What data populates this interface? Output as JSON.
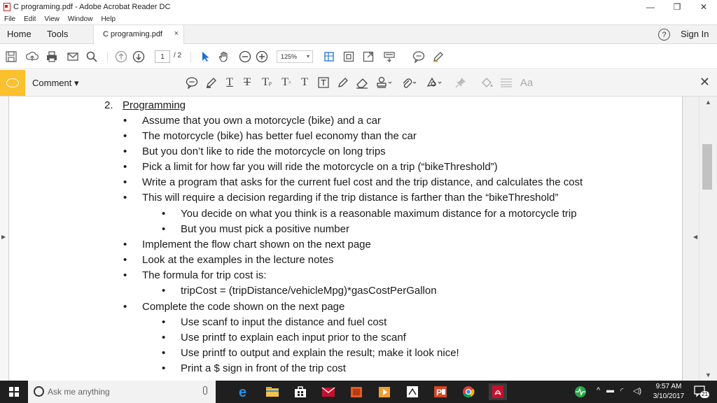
{
  "window": {
    "title": "C programing.pdf - Adobe Acrobat Reader DC",
    "minimize": "—",
    "restore": "❐",
    "close": "✕"
  },
  "menu": [
    "File",
    "Edit",
    "View",
    "Window",
    "Help"
  ],
  "tabs": {
    "home": "Home",
    "tools": "Tools",
    "document": "C programing.pdf",
    "document_close": "×",
    "help": "?",
    "sign_in": "Sign In"
  },
  "toolbar": {
    "current_page": "1",
    "total_pages": "/ 2",
    "zoom": "125%"
  },
  "comment_bar": {
    "label": "Comment ▾",
    "font_size_label": "Aa",
    "close": "✕"
  },
  "document": {
    "heading_number": "2.",
    "heading_title": "Programming",
    "bullet": "•",
    "lines": [
      "Assume that you own a motorcycle (bike) and a car",
      "The motorcycle (bike) has better fuel economy than the car",
      "But you don’t like to ride the motorcycle on long trips",
      "Pick a limit for how far you will ride the motorcycle on a trip (“bikeThreshold”)",
      "Write a program that asks for the current fuel cost and the trip distance, and calculates the cost",
      "This will require a decision regarding if the trip distance is farther than the “bikeThreshold”",
      "You decide on what you think is a reasonable maximum distance for a motorcycle trip",
      "But you must pick a positive number",
      "Implement the flow chart shown on the next page",
      "Look at the examples in the lecture notes",
      "The formula for trip cost is:",
      "tripCost = (tripDistance/vehicleMpg)*gasCostPerGallon",
      "Complete the code shown on the next page",
      "Use scanf to input the distance and fuel cost",
      "Use printf to explain each input prior to the scanf",
      "Use printf to output and explain the result; make it look nice!",
      "Print a $ sign in front of the trip cost"
    ]
  },
  "taskbar": {
    "search_placeholder": "Ask me anything",
    "time": "9:57 AM",
    "date": "3/10/2017",
    "notification_count": "21"
  }
}
